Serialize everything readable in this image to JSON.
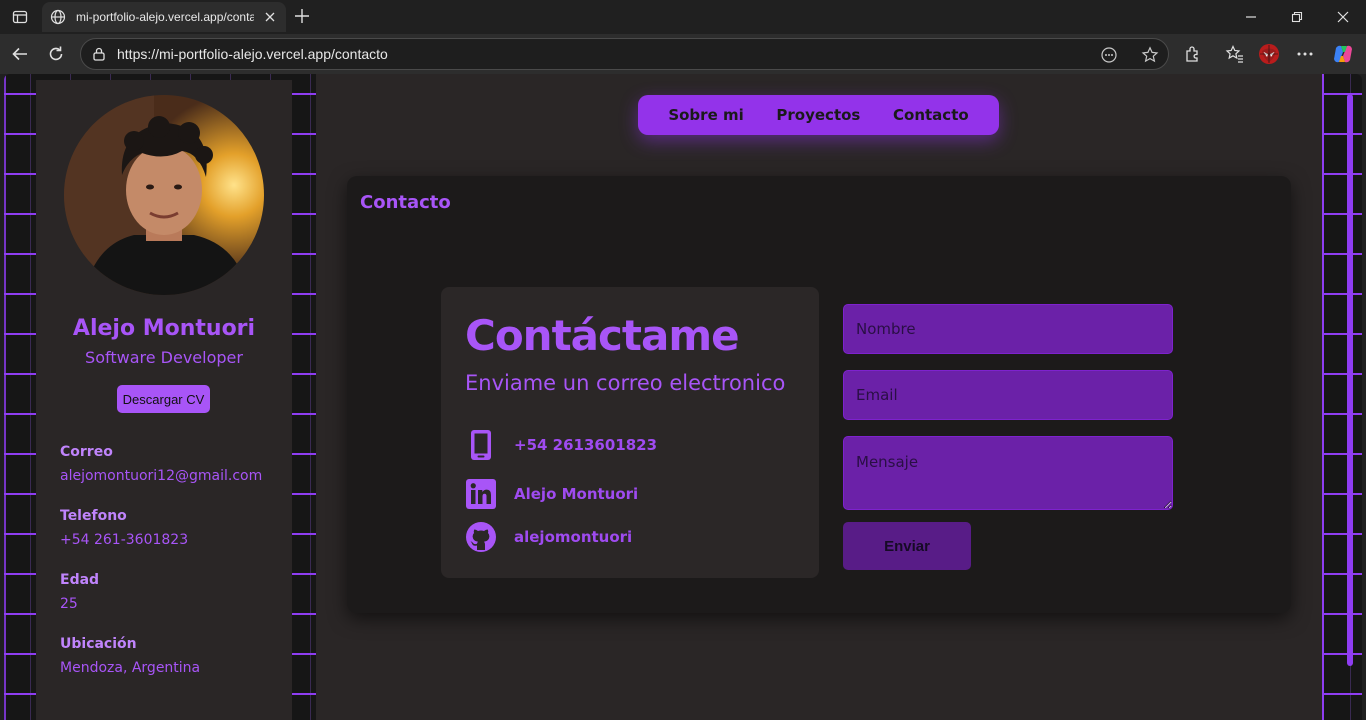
{
  "browser": {
    "tab_title": "mi-portfolio-alejo.vercel.app/contacto",
    "url": "https://mi-portfolio-alejo.vercel.app/contacto"
  },
  "sidebar": {
    "name": "Alejo Montuori",
    "role": "Software Developer",
    "cv_button": "Descargar CV",
    "info": [
      {
        "label": "Correo",
        "value": "alejomontuori12@gmail.com"
      },
      {
        "label": "Telefono",
        "value": "+54 261-3601823"
      },
      {
        "label": "Edad",
        "value": "25"
      },
      {
        "label": "Ubicación",
        "value": "Mendoza, Argentina"
      }
    ]
  },
  "nav": {
    "items": [
      "Sobre mi",
      "Proyectos",
      "Contacto"
    ]
  },
  "contact": {
    "section_title": "Contacto",
    "heading": "Contáctame",
    "subheading": "Enviame un correo electronico",
    "items": [
      {
        "icon": "phone-icon",
        "text": "+54 2613601823"
      },
      {
        "icon": "linkedin-icon",
        "text": "Alejo Montuori"
      },
      {
        "icon": "github-icon",
        "text": "alejomontuori"
      }
    ]
  },
  "form": {
    "name_placeholder": "Nombre",
    "email_placeholder": "Email",
    "message_placeholder": "Mensaje",
    "submit_label": "Enviar"
  },
  "colors": {
    "accent": "#a855f7",
    "nav_bg": "#9333ea",
    "input_bg": "#6b21a8",
    "button_bg": "#581c87"
  }
}
